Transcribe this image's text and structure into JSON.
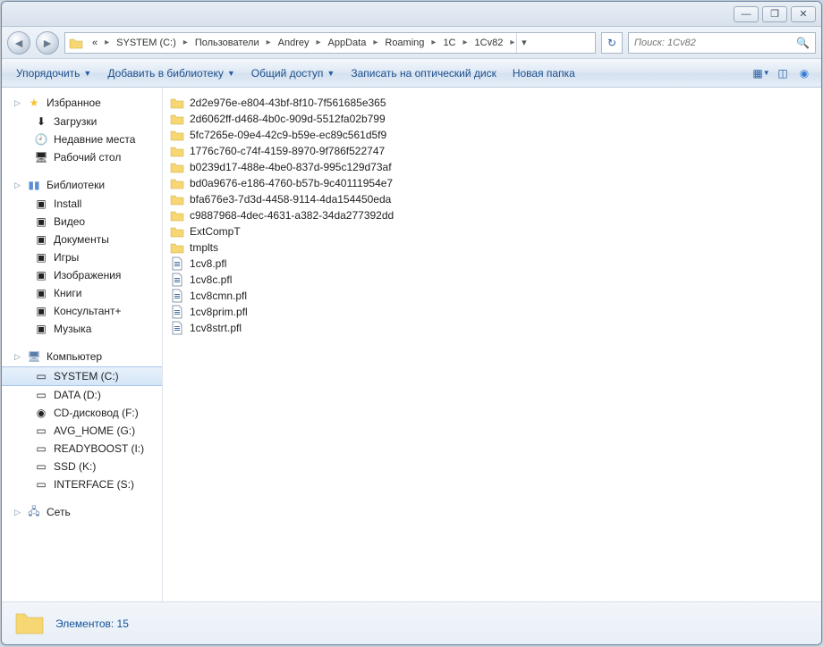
{
  "titlebar": {
    "min": "—",
    "max": "❐",
    "close": "✕"
  },
  "nav": {
    "back": "◄",
    "forward": "►",
    "segments": [
      "«",
      "SYSTEM (C:)",
      "Пользователи",
      "Andrey",
      "AppData",
      "Roaming",
      "1C",
      "1Cv82"
    ],
    "refresh": "↻",
    "search_placeholder": "Поиск: 1Cv82",
    "search_icon": "🔍"
  },
  "toolbar": {
    "organize": "Упорядочить",
    "add_library": "Добавить в библиотеку",
    "share": "Общий доступ",
    "burn": "Записать на оптический диск",
    "new_folder": "Новая папка"
  },
  "sidebar": {
    "favorites": {
      "label": "Избранное",
      "items": [
        {
          "label": "Загрузки"
        },
        {
          "label": "Недавние места"
        },
        {
          "label": "Рабочий стол"
        }
      ]
    },
    "libraries": {
      "label": "Библиотеки",
      "items": [
        {
          "label": "Install"
        },
        {
          "label": "Видео"
        },
        {
          "label": "Документы"
        },
        {
          "label": "Игры"
        },
        {
          "label": "Изображения"
        },
        {
          "label": "Книги"
        },
        {
          "label": "Консультант+"
        },
        {
          "label": "Музыка"
        }
      ]
    },
    "computer": {
      "label": "Компьютер",
      "items": [
        {
          "label": "SYSTEM (C:)",
          "selected": true
        },
        {
          "label": "DATA (D:)"
        },
        {
          "label": "CD-дисковод (F:)"
        },
        {
          "label": "AVG_HOME (G:)"
        },
        {
          "label": "READYBOOST (I:)"
        },
        {
          "label": "SSD (K:)"
        },
        {
          "label": "INTERFACE (S:)"
        }
      ]
    },
    "network": {
      "label": "Сеть"
    }
  },
  "items": [
    {
      "type": "folder",
      "name": "2d2e976e-e804-43bf-8f10-7f561685e365"
    },
    {
      "type": "folder",
      "name": "2d6062ff-d468-4b0c-909d-5512fa02b799"
    },
    {
      "type": "folder",
      "name": "5fc7265e-09e4-42c9-b59e-ec89c561d5f9"
    },
    {
      "type": "folder",
      "name": "1776c760-c74f-4159-8970-9f786f522747"
    },
    {
      "type": "folder",
      "name": "b0239d17-488e-4be0-837d-995c129d73af"
    },
    {
      "type": "folder",
      "name": "bd0a9676-e186-4760-b57b-9c40111954e7"
    },
    {
      "type": "folder",
      "name": "bfa676e3-7d3d-4458-9114-4da154450eda"
    },
    {
      "type": "folder",
      "name": "c9887968-4dec-4631-a382-34da277392dd"
    },
    {
      "type": "folder",
      "name": "ExtCompT"
    },
    {
      "type": "folder",
      "name": "tmplts"
    },
    {
      "type": "file",
      "name": "1cv8.pfl"
    },
    {
      "type": "file",
      "name": "1cv8c.pfl"
    },
    {
      "type": "file",
      "name": "1cv8cmn.pfl"
    },
    {
      "type": "file",
      "name": "1cv8prim.pfl"
    },
    {
      "type": "file",
      "name": "1cv8strt.pfl"
    }
  ],
  "status": {
    "text": "Элементов: 15"
  }
}
